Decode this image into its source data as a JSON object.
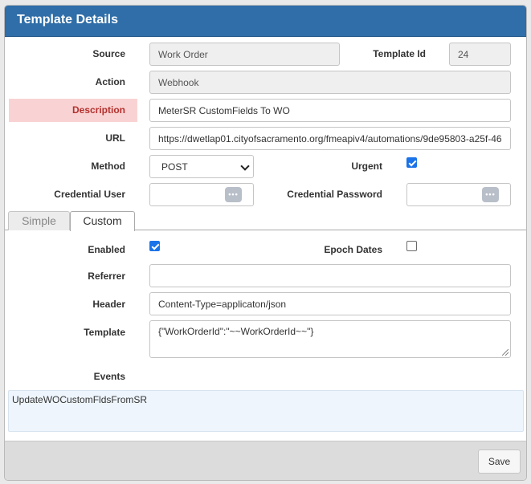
{
  "title": "Template Details",
  "fields": {
    "source_label": "Source",
    "source_value": "Work Order",
    "template_id_label": "Template Id",
    "template_id_value": "24",
    "action_label": "Action",
    "action_value": "Webhook",
    "description_label": "Description",
    "description_value": "MeterSR CustomFields To WO",
    "url_label": "URL",
    "url_value": "https://dwetlap01.cityofsacramento.org/fmeapiv4/automations/9de95803-a25f-46",
    "method_label": "Method",
    "method_value": "POST",
    "urgent_label": "Urgent",
    "urgent_checked": true,
    "credential_user_label": "Credential User",
    "credential_user_value": "",
    "credential_password_label": "Credential Password",
    "credential_password_value": ""
  },
  "tabs": [
    {
      "label": "Simple",
      "active": false
    },
    {
      "label": "Custom",
      "active": true
    }
  ],
  "custom": {
    "enabled_label": "Enabled",
    "enabled_checked": true,
    "epoch_dates_label": "Epoch Dates",
    "epoch_dates_checked": false,
    "referrer_label": "Referrer",
    "referrer_value": "",
    "header_label": "Header",
    "header_value": "Content-Type=applicaton/json",
    "template_label": "Template",
    "template_value": "{\"WorkOrderId\":\"~~WorkOrderId~~\"}",
    "events_label": "Events",
    "events": [
      "UpdateWOCustomFldsFromSR"
    ]
  },
  "footer": {
    "save_label": "Save"
  },
  "colors": {
    "titlebar": "#2f6ea8",
    "error_bg": "#f9d3d3",
    "error_text": "#b3302e",
    "checkbox_on": "#1a73e8"
  },
  "icons": {
    "password_manager": "dots-key-icon",
    "select_arrow": "chevron-down-icon",
    "checkbox_check": "check-icon",
    "textarea_resize": "resize-grip-icon"
  }
}
